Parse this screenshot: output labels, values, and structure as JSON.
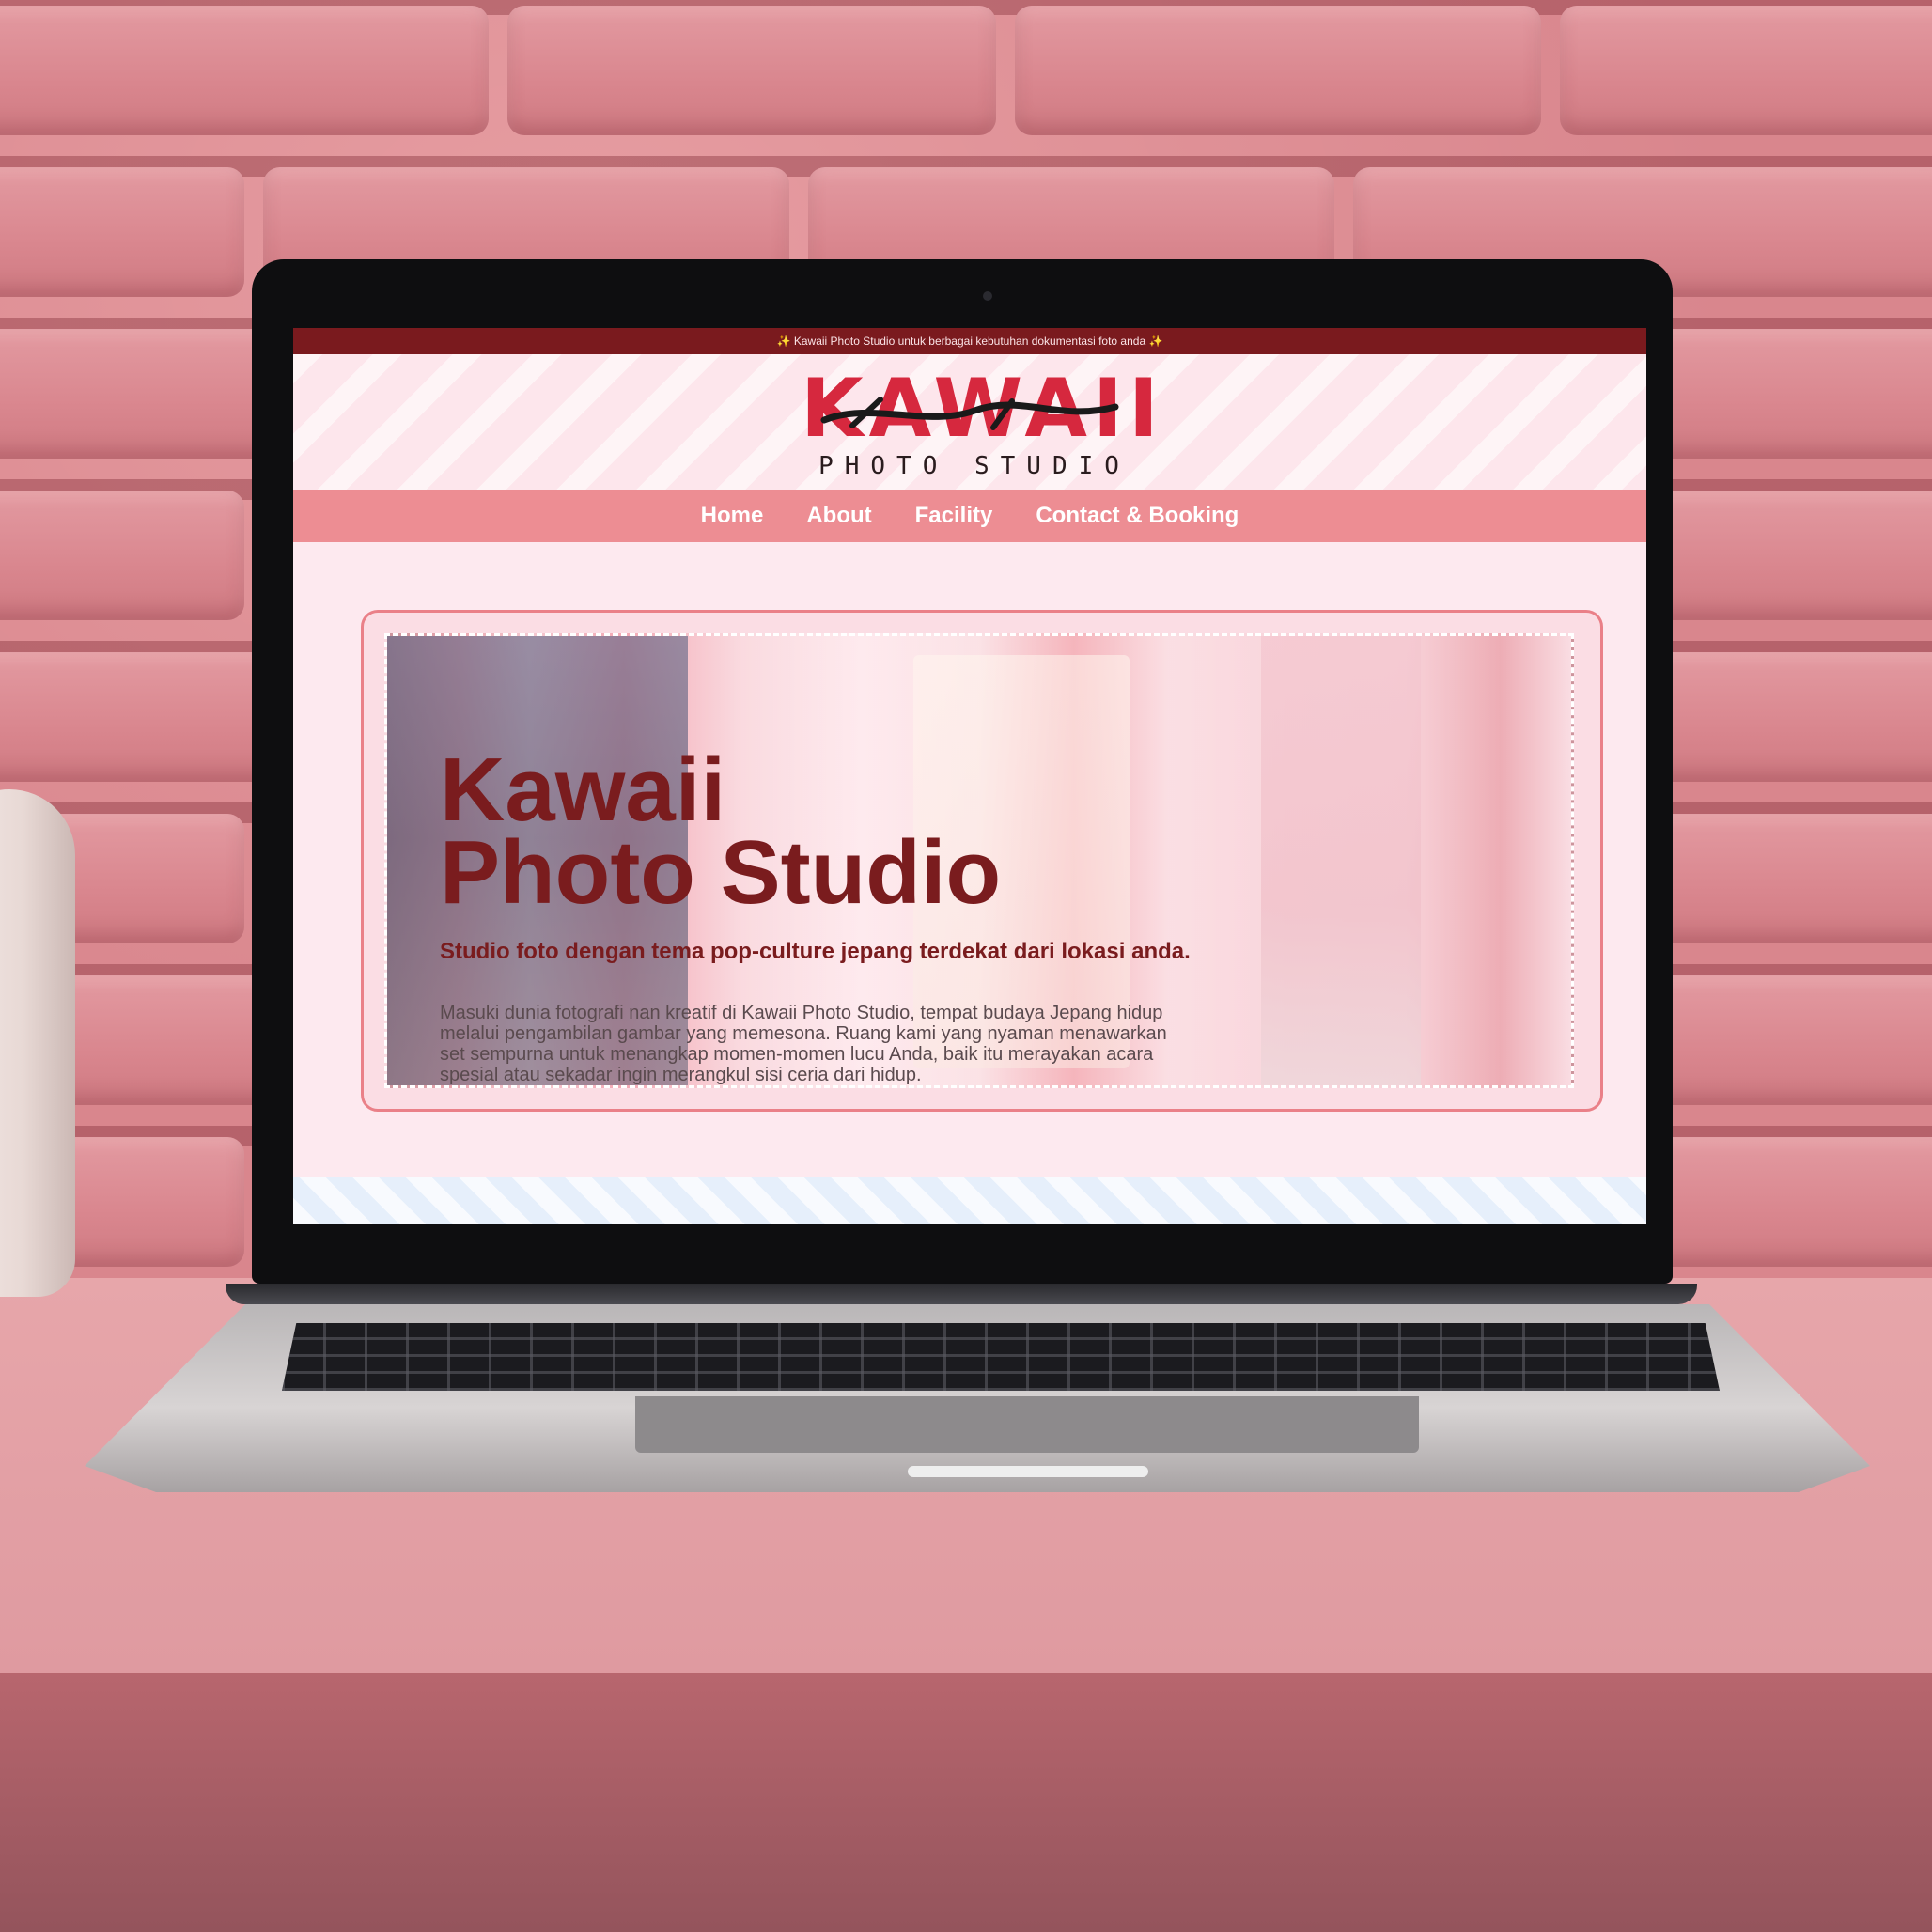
{
  "announcement": "✨ Kawaii Photo Studio untuk berbagai kebutuhan dokumentasi foto anda ✨",
  "logo": {
    "word": "KAWAII",
    "subtitle": "PHOTO STUDIO"
  },
  "nav": {
    "items": [
      {
        "label": "Home"
      },
      {
        "label": "About"
      },
      {
        "label": "Facility"
      },
      {
        "label": "Contact & Booking"
      }
    ]
  },
  "hero": {
    "title_line1": "Kawaii",
    "title_line2": "Photo Studio",
    "tagline": "Studio foto dengan tema pop-culture jepang terdekat dari lokasi anda.",
    "body": "Masuki dunia fotografi nan kreatif di Kawaii Photo Studio, tempat budaya Jepang hidup melalui pengambilan gambar yang memesona. Ruang kami yang nyaman menawarkan set sempurna untuk menangkap momen-momen lucu Anda, baik itu merayakan acara spesial atau sekadar ingin merangkul sisi ceria dari hidup."
  },
  "colors": {
    "accent_dark": "#7a1a1e",
    "logo_red": "#d6283e",
    "nav_pink": "#ed8d93",
    "page_bg": "#fde9ef"
  }
}
